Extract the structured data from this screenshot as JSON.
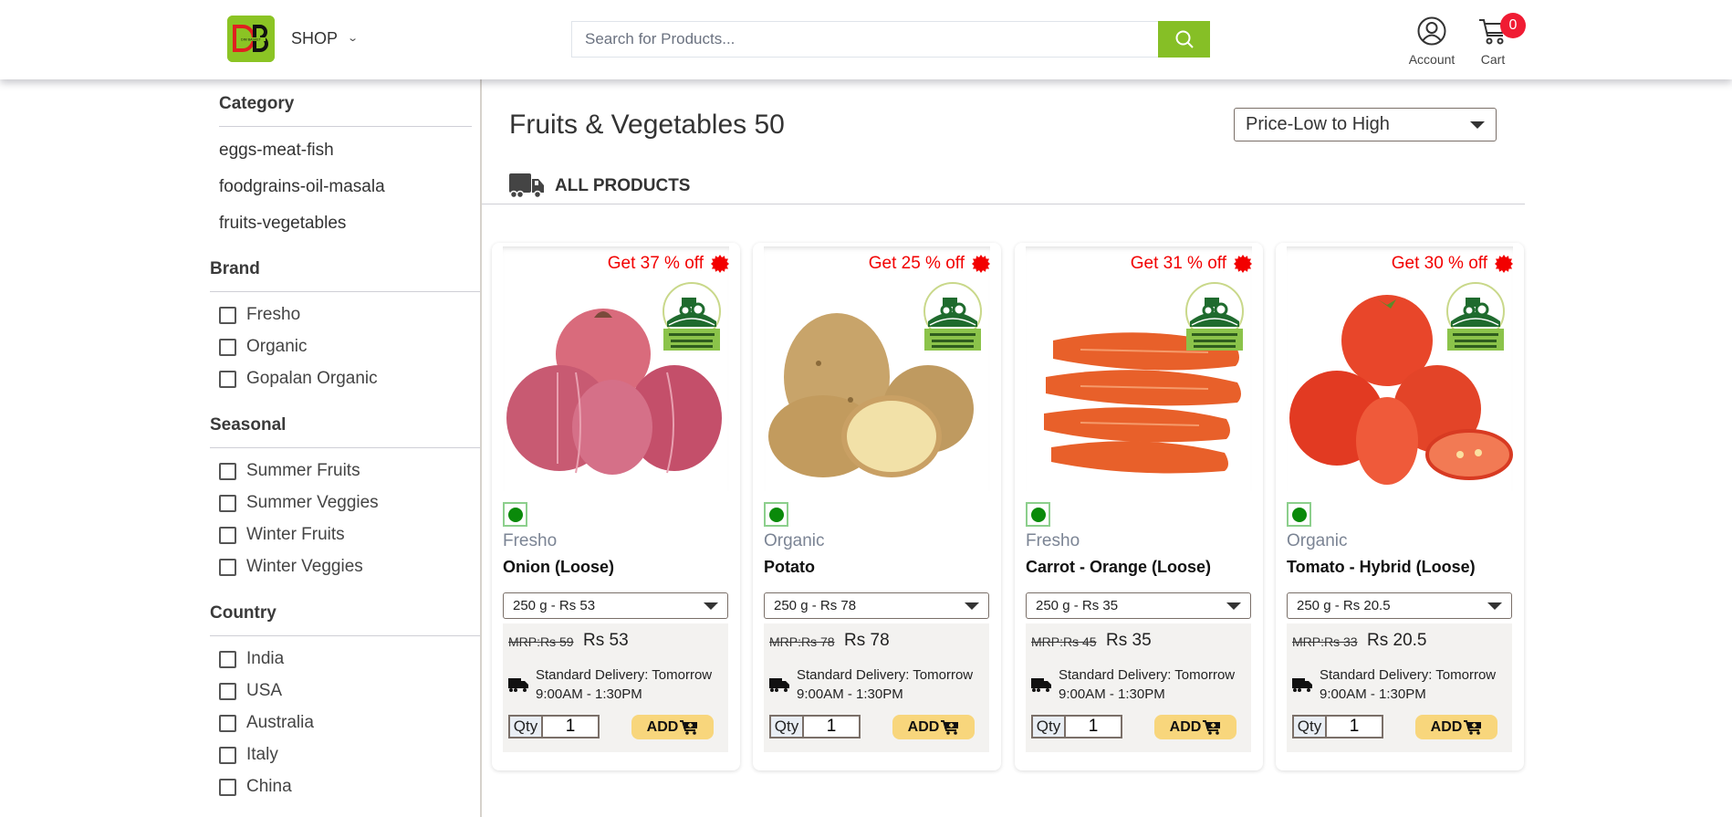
{
  "header": {
    "logo_text": "DB",
    "logo_subtext": "DIM BASKET",
    "shop_label": "SHOP",
    "search_placeholder": "Search for Products...",
    "account_label": "Account",
    "cart_label": "Cart",
    "cart_count": "0"
  },
  "sidebar": {
    "category_title": "Category",
    "categories": [
      "eggs-meat-fish",
      "foodgrains-oil-masala",
      "fruits-vegetables"
    ],
    "brand_title": "Brand",
    "brands": [
      "Fresho",
      "Organic",
      "Gopalan Organic"
    ],
    "seasonal_title": "Seasonal",
    "seasonal": [
      "Summer Fruits",
      "Summer Veggies",
      "Winter Fruits",
      "Winter Veggies"
    ],
    "country_title": "Country",
    "countries": [
      "India",
      "USA",
      "Australia",
      "Italy",
      "China"
    ]
  },
  "main": {
    "title": "Fruits & Vegetables 50",
    "sort_selected": "Price-Low to High",
    "section_label": "ALL PRODUCTS"
  },
  "products": [
    {
      "offer": "Get 37 % off",
      "brand": "Fresho",
      "name": "Onion (Loose)",
      "variant": "250 g - Rs 53",
      "mrp": "MRP:Rs 59",
      "price": "Rs 53",
      "delivery_line1": "Standard Delivery: Tomorrow",
      "delivery_line2": "9:00AM - 1:30PM",
      "qty_label": "Qty",
      "qty": "1",
      "add_label": "ADD",
      "image": "onion"
    },
    {
      "offer": "Get 25 % off",
      "brand": "Organic",
      "name": "Potato",
      "variant": "250 g - Rs 78",
      "mrp": "MRP:Rs 78",
      "price": "Rs 78",
      "delivery_line1": "Standard Delivery: Tomorrow",
      "delivery_line2": "9:00AM - 1:30PM",
      "qty_label": "Qty",
      "qty": "1",
      "add_label": "ADD",
      "image": "potato"
    },
    {
      "offer": "Get 31 % off",
      "brand": "Fresho",
      "name": "Carrot - Orange (Loose)",
      "variant": "250 g - Rs 35",
      "mrp": "MRP:Rs 45",
      "price": "Rs 35",
      "delivery_line1": "Standard Delivery: Tomorrow",
      "delivery_line2": "9:00AM - 1:30PM",
      "qty_label": "Qty",
      "qty": "1",
      "add_label": "ADD",
      "image": "carrot"
    },
    {
      "offer": "Get 30 % off",
      "brand": "Organic",
      "name": "Tomato - Hybrid (Loose)",
      "variant": "250 g - Rs 20.5",
      "mrp": "MRP:Rs 33",
      "price": "Rs 20.5",
      "delivery_line1": "Standard Delivery: Tomorrow",
      "delivery_line2": "9:00AM - 1:30PM",
      "qty_label": "Qty",
      "qty": "1",
      "add_label": "ADD",
      "image": "tomato"
    }
  ],
  "colors": {
    "brand_green": "#86bf26",
    "offer_red": "#f20000",
    "badge_red": "#f01c33",
    "add_button": "#f8d67c",
    "veg_dot": "#0a8a0a"
  }
}
